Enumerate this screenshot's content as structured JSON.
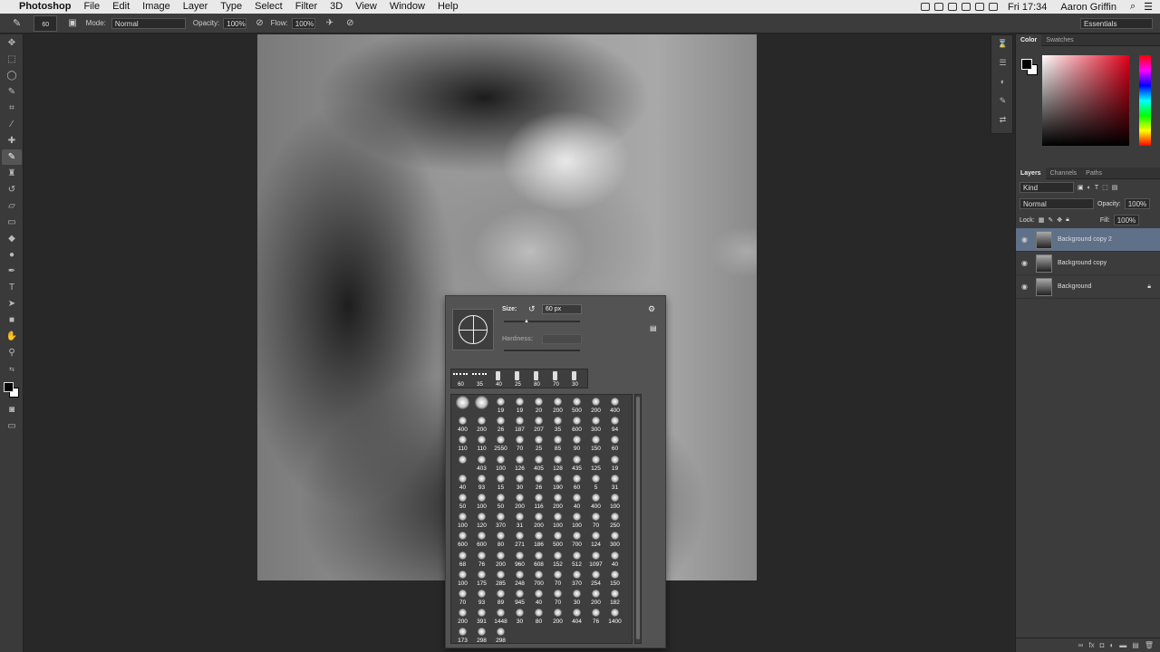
{
  "menubar": {
    "apple": "",
    "app": "Photoshop",
    "items": [
      "File",
      "Edit",
      "Image",
      "Layer",
      "Type",
      "Select",
      "Filter",
      "3D",
      "View",
      "Window",
      "Help"
    ],
    "clock": "Fri 17:34",
    "user": "Aaron Griffin"
  },
  "options": {
    "brush_size": "60",
    "mode_label": "Mode:",
    "mode_value": "Normal",
    "opacity_label": "Opacity:",
    "opacity_value": "100%",
    "flow_label": "Flow:",
    "flow_value": "100%",
    "workspace": "Essentials"
  },
  "brush_picker": {
    "size_label": "Size:",
    "size_value": "60 px",
    "hardness_label": "Hardness:",
    "hardness_value": "",
    "recent": [
      "60",
      "35",
      "40",
      "25",
      "80",
      "70",
      "30"
    ],
    "presets": [
      "",
      "",
      "19",
      "19",
      "20",
      "200",
      "500",
      "200",
      "400",
      "400",
      "200",
      "26",
      "187",
      "207",
      "35",
      "600",
      "300",
      "94",
      "110",
      "110",
      "2550",
      "70",
      "25",
      "85",
      "90",
      "150",
      "60",
      "",
      "403",
      "100",
      "126",
      "405",
      "128",
      "435",
      "125",
      "19",
      "40",
      "93",
      "15",
      "30",
      "26",
      "190",
      "60",
      "5",
      "31",
      "50",
      "100",
      "50",
      "200",
      "116",
      "200",
      "40",
      "400",
      "100",
      "100",
      "120",
      "370",
      "31",
      "200",
      "100",
      "100",
      "70",
      "250",
      "600",
      "600",
      "80",
      "271",
      "186",
      "500",
      "700",
      "124",
      "300",
      "68",
      "76",
      "200",
      "960",
      "608",
      "152",
      "512",
      "1097",
      "40",
      "100",
      "175",
      "285",
      "248",
      "700",
      "70",
      "370",
      "254",
      "150",
      "70",
      "93",
      "89",
      "945",
      "40",
      "70",
      "30",
      "200",
      "182",
      "200",
      "391",
      "1448",
      "30",
      "80",
      "200",
      "404",
      "76",
      "1400",
      "173",
      "298",
      "298"
    ]
  },
  "color_panel": {
    "tabs": [
      "Color",
      "Swatches"
    ]
  },
  "layers_panel": {
    "tabs": [
      "Layers",
      "Channels",
      "Paths"
    ],
    "kind": "Kind",
    "blend": "Normal",
    "opacity_label": "Opacity:",
    "opacity_value": "100%",
    "lock_label": "Lock:",
    "fill_label": "Fill:",
    "fill_value": "100%",
    "layers": [
      {
        "name": "Background copy 2",
        "selected": true
      },
      {
        "name": "Background copy",
        "selected": false
      },
      {
        "name": "Background",
        "selected": false,
        "locked": true
      }
    ]
  },
  "colors": {
    "selected_layer": "#5f7089"
  }
}
